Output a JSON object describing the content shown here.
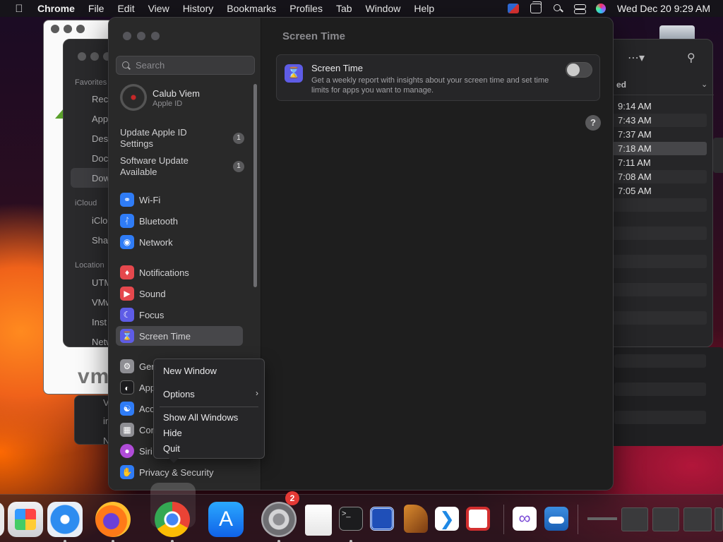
{
  "menubar": {
    "app_name": "Chrome",
    "items": [
      "File",
      "Edit",
      "View",
      "History",
      "Bookmarks",
      "Profiles",
      "Tab",
      "Window",
      "Help"
    ],
    "clock": "Wed Dec 20  9:29 AM"
  },
  "finder": {
    "favorites_head": "Favorites",
    "items": [
      "Rec",
      "App",
      "Des",
      "Doc",
      "Dow"
    ],
    "icloud_head": "iCloud",
    "icloud_items": [
      "iClo",
      "Sha"
    ],
    "locations_head": "Location",
    "location_items": [
      "UTM",
      "VMw",
      "Inst",
      "Netw"
    ],
    "lower_items": [
      "V",
      "in",
      "N"
    ],
    "vm_text": "vm"
  },
  "right_window": {
    "sort_label": "ed",
    "times": [
      "9:14 AM",
      "7:43 AM",
      "7:37 AM",
      "7:18 AM",
      "7:11 AM",
      "7:08 AM",
      "7:05 AM"
    ],
    "selected_index": 3
  },
  "settings": {
    "search_placeholder": "Search",
    "account": {
      "name": "Calub Viem",
      "sub": "Apple ID"
    },
    "notices": [
      {
        "label": "Update Apple ID Settings",
        "badge": "1"
      },
      {
        "label": "Software Update Available",
        "badge": "1"
      }
    ],
    "sidebar_items": [
      {
        "label": "Wi-Fi",
        "icon": "wifi-icon",
        "color": "#2f7cf6"
      },
      {
        "label": "Bluetooth",
        "icon": "bluetooth-icon",
        "color": "#2f7cf6"
      },
      {
        "label": "Network",
        "icon": "globe-icon",
        "color": "#2f7cf6"
      },
      {
        "label": "Notifications",
        "icon": "bell-icon",
        "color": "#e5484d"
      },
      {
        "label": "Sound",
        "icon": "speaker-icon",
        "color": "#e5484d"
      },
      {
        "label": "Focus",
        "icon": "moon-icon",
        "color": "#5e5ce6"
      },
      {
        "label": "Screen Time",
        "icon": "hourglass-icon",
        "color": "#5e5ce6"
      },
      {
        "label": "Gen",
        "icon": "gear-icon",
        "color": "#8e8e93"
      },
      {
        "label": "App",
        "icon": "appearance-icon",
        "color": "#1c1c1e"
      },
      {
        "label": "Acc",
        "icon": "accessibility-icon",
        "color": "#2f7cf6"
      },
      {
        "label": "Con",
        "icon": "control-center-icon",
        "color": "#8e8e93"
      },
      {
        "label": "Siri",
        "icon": "siri-icon",
        "color": "#b04cd8"
      },
      {
        "label": "Privacy & Security",
        "icon": "hand-icon",
        "color": "#2f7cf6"
      }
    ],
    "selected_item": "Screen Time",
    "content_title": "Screen Time",
    "card": {
      "title": "Screen Time",
      "description": "Get a weekly report with insights about your screen time and set time limits for apps you want to manage.",
      "toggle_on": false
    },
    "help_label": "?"
  },
  "context_menu": {
    "items": [
      "New Window",
      "Options",
      "Show All Windows",
      "Hide",
      "Quit"
    ]
  },
  "dock": {
    "badge_count": "2",
    "apps": [
      "launchpad-icon",
      "safari-icon",
      "firefox-icon",
      "chrome-icon",
      "app-store-icon",
      "system-settings-icon",
      "textedit-icon",
      "terminal-icon",
      "screens-icon",
      "garageband-icon",
      "vscode-icon",
      "parallels-icon",
      "visual-studio-icon",
      "weather-icon"
    ]
  }
}
